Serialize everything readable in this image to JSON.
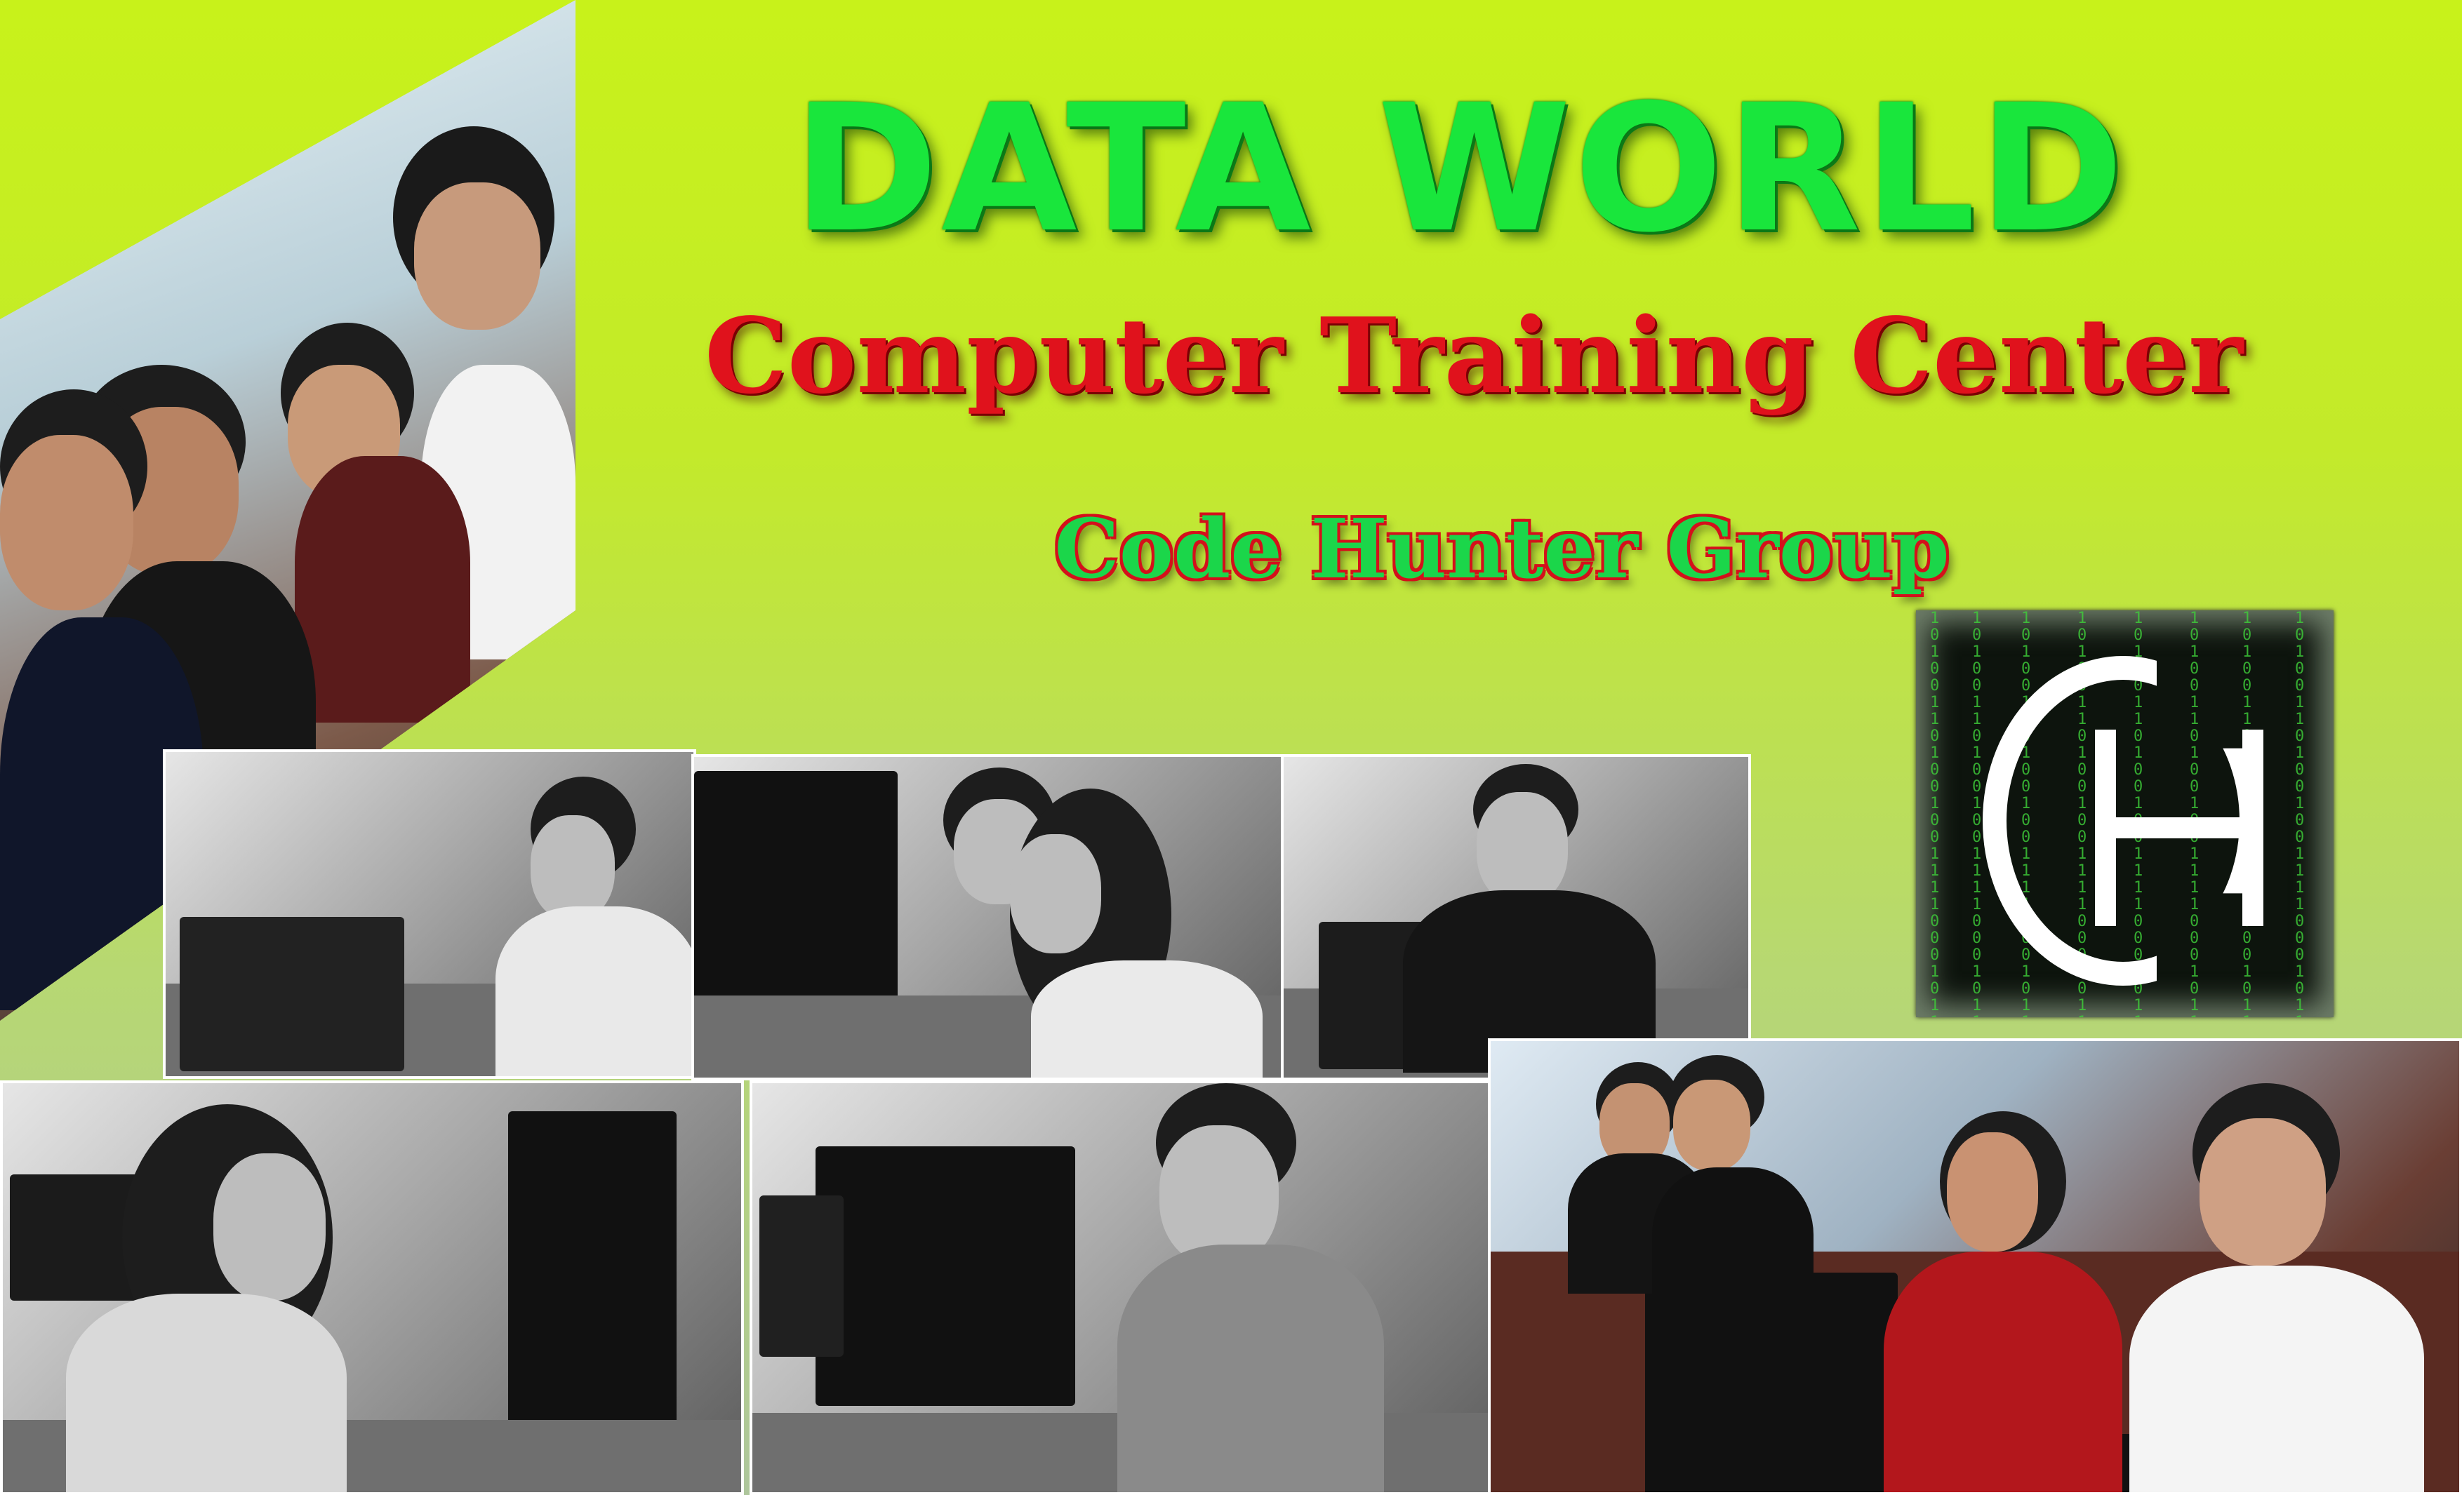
{
  "banner": {
    "title": "DATA WORLD",
    "subtitle": "Computer Training Center",
    "group": "Code Hunter Group"
  },
  "colors": {
    "background_top": "#c8f21a",
    "background_bottom": "#aec69c",
    "title": "#19e63c",
    "subtitle": "#e0121c",
    "group_fill": "#1bd64a",
    "group_outline": "#d4101b",
    "logo_code": "#3fd13a"
  },
  "logo": {
    "icon": "code-hunter-logo-icon",
    "code_rain": "1010 0110 1001 0011 1100 0101 1011 0010 1110 0001 1001 0110 1010 0101 1101 0011 0110 1001 1010 0110 1001 0011 1100 0101 1011 0010 1110 0001 1001 0110"
  }
}
